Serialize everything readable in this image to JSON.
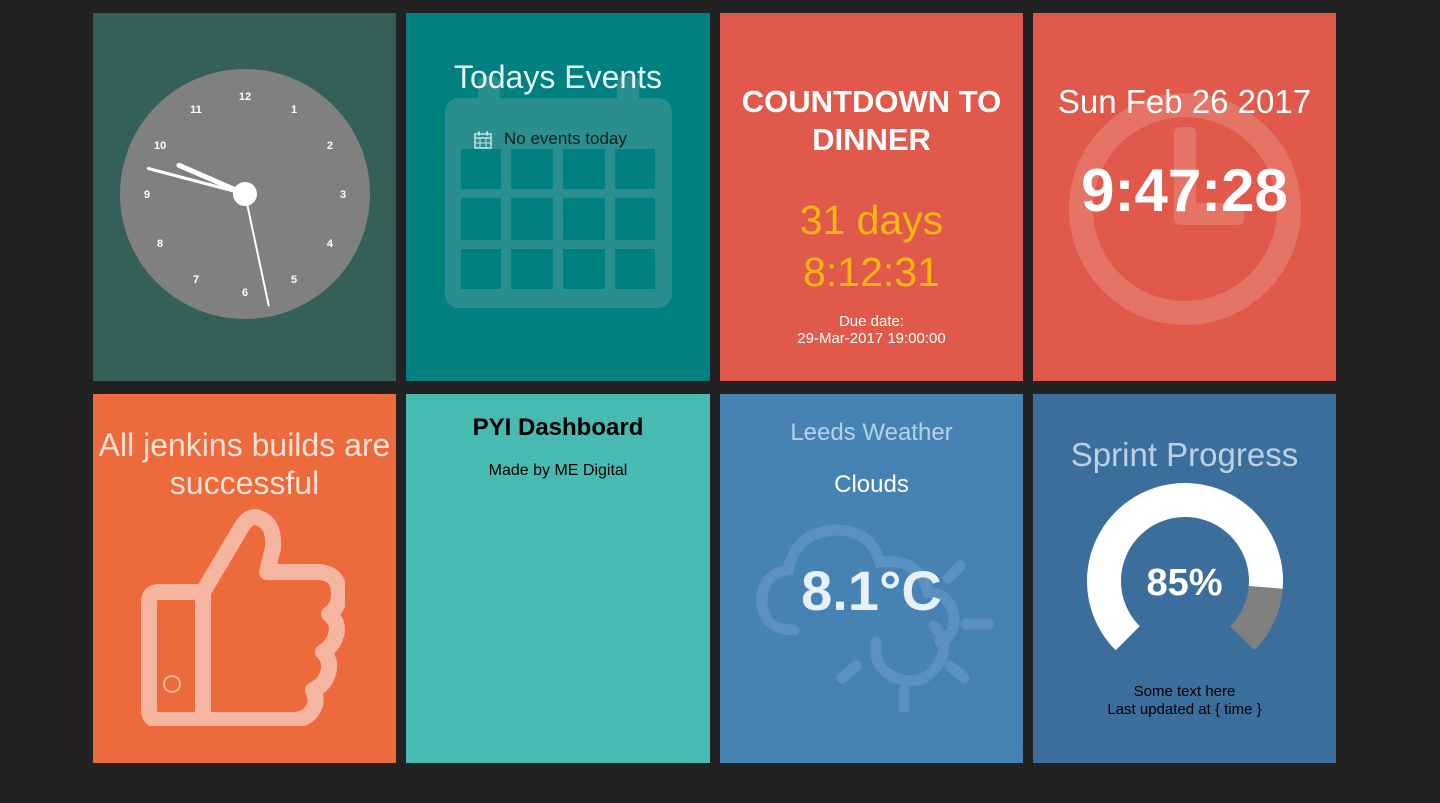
{
  "clock": {
    "numbers": [
      "12",
      "1",
      "2",
      "3",
      "4",
      "5",
      "6",
      "7",
      "8",
      "9",
      "10",
      "11"
    ],
    "time": {
      "hour": 9,
      "minute": 47,
      "second": 28
    }
  },
  "events": {
    "title": "Todays Events",
    "empty_text": "No events today"
  },
  "countdown": {
    "title_line1": "COUNTDOWN TO",
    "title_line2": "DINNER",
    "days": "31 days",
    "remaining": "8:12:31",
    "due_label": "Due date:",
    "due_date": "29-Mar-2017 19:00:00"
  },
  "datetime": {
    "date": "Sun Feb 26 2017",
    "time": "9:47:28"
  },
  "jenkins": {
    "line1": "All jenkins builds are",
    "line2": "successful"
  },
  "text_widget": {
    "title": "PYI Dashboard",
    "subtitle": "Made by ME Digital"
  },
  "weather": {
    "title": "Leeds Weather",
    "condition": "Clouds",
    "temperature": "8.1°C"
  },
  "sprint": {
    "title": "Sprint Progress",
    "percent_label": "85%",
    "progress": 0.85,
    "more_info": "Some text here",
    "updated": "Last updated at { time }"
  },
  "colors": {
    "clock_bg": "#35605a",
    "events_bg": "#008080",
    "countdown_bg": "#e0594a",
    "time_bg": "#e0594a",
    "jenkins_bg": "#ec6a3c",
    "text_bg": "#47bab2",
    "weather_bg": "#4682b4",
    "sprint_bg": "#3b6e9a",
    "countdown_accent": "#f9b710"
  },
  "icons": {
    "events": "calendar-icon",
    "time": "clock-icon",
    "jenkins": "thumbs-up-icon",
    "weather": "cloud-sun-icon"
  }
}
